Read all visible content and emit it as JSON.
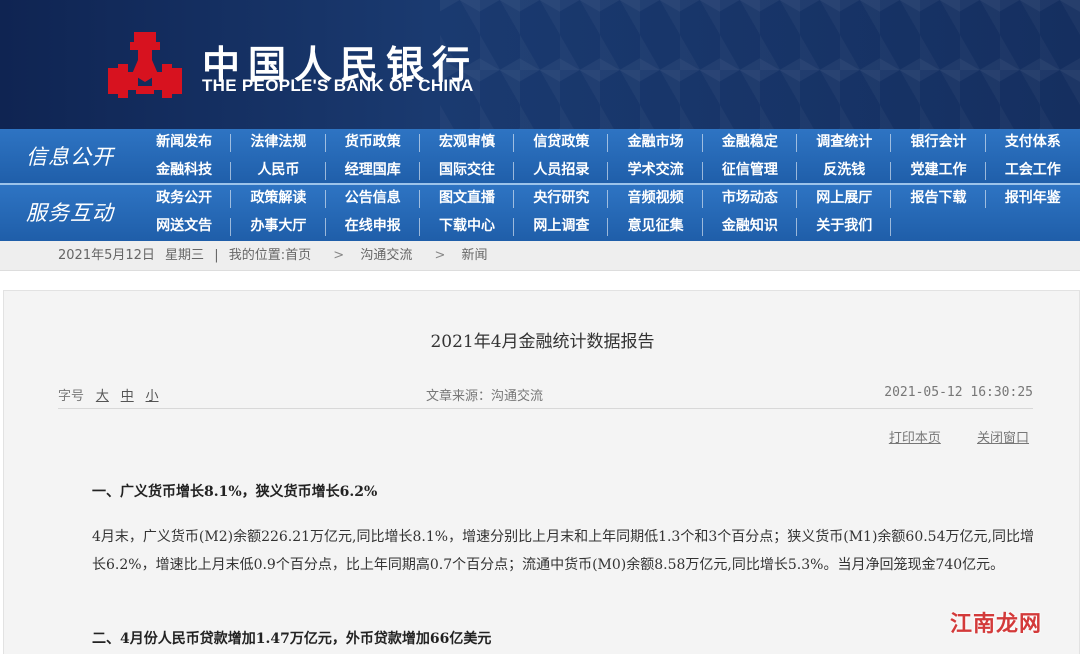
{
  "header": {
    "title_cn": "中国人民银行",
    "title_en": "THE PEOPLE'S BANK OF CHINA",
    "brand_color": "#d7121f"
  },
  "nav": {
    "section1_title": "信息公开",
    "section2_title": "服务互动",
    "rows": [
      [
        "新闻发布",
        "法律法规",
        "货币政策",
        "宏观审慎",
        "信贷政策",
        "金融市场",
        "金融稳定",
        "调查统计",
        "银行会计",
        "支付体系"
      ],
      [
        "金融科技",
        "人民币",
        "经理国库",
        "国际交往",
        "人员招录",
        "学术交流",
        "征信管理",
        "反洗钱",
        "党建工作",
        "工会工作"
      ],
      [
        "政务公开",
        "政策解读",
        "公告信息",
        "图文直播",
        "央行研究",
        "音频视频",
        "市场动态",
        "网上展厅",
        "报告下载",
        "报刊年鉴"
      ],
      [
        "网送文告",
        "办事大厅",
        "在线申报",
        "下载中心",
        "网上调查",
        "意见征集",
        "金融知识",
        "关于我们"
      ]
    ]
  },
  "breadcrumb": {
    "date": "2021年5月12日",
    "weekday": "星期三",
    "divider": "|",
    "location_label": "我的位置:",
    "home": "首页",
    "level1": "沟通交流",
    "level2": "新闻",
    "arrow": ">"
  },
  "article": {
    "title": "2021年4月金融统计数据报告",
    "font_size_label": "字号",
    "size_large": "大",
    "size_medium": "中",
    "size_small": "小",
    "source": "文章来源：沟通交流",
    "timestamp": "2021-05-12 16:30:25",
    "print": "打印本页",
    "close": "关闭窗口",
    "section1_heading": "一、广义货币增长8.1%，狭义货币增长6.2%",
    "section1_body": "4月末，广义货币(M2)余额226.21万亿元,同比增长8.1%，增速分别比上月末和上年同期低1.3个和3个百分点；狭义货币(M1)余额60.54万亿元,同比增长6.2%，增速比上月末低0.9个百分点，比上年同期高0.7个百分点；流通中货币(M0)余额8.58万亿元,同比增长5.3%。当月净回笼现金740亿元。",
    "section2_heading": "二、4月份人民币贷款增加1.47万亿元，外币贷款增加66亿美元"
  },
  "watermark": "江南龙网"
}
